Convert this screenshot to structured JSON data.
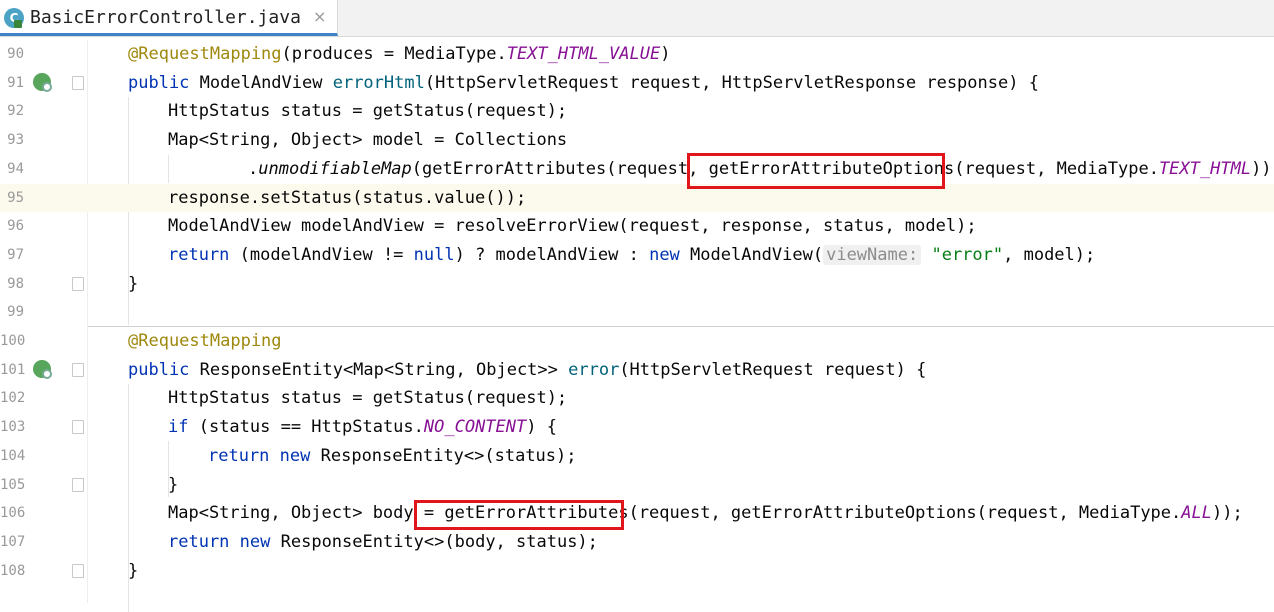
{
  "tab": {
    "title": "BasicErrorController.java",
    "icon_letter": "C",
    "close": "×"
  },
  "colors": {
    "keyword": "#0033b3",
    "annotation": "#9e880d",
    "static_field": "#871094",
    "method": "#00627a",
    "string": "#067d17",
    "highlight_box": "#e0161c"
  },
  "lines": [
    {
      "num": "90"
    },
    {
      "num": "91"
    },
    {
      "num": "92"
    },
    {
      "num": "93"
    },
    {
      "num": "94"
    },
    {
      "num": "95"
    },
    {
      "num": "96"
    },
    {
      "num": "97"
    },
    {
      "num": "98"
    },
    {
      "num": "99"
    },
    {
      "num": "100"
    },
    {
      "num": "101"
    },
    {
      "num": "102"
    },
    {
      "num": "103"
    },
    {
      "num": "104"
    },
    {
      "num": "105"
    },
    {
      "num": "106"
    },
    {
      "num": "107"
    },
    {
      "num": "108"
    }
  ],
  "code": {
    "l90": {
      "ann": "@RequestMapping",
      "a": "(produces = MediaType.",
      "st": "TEXT_HTML_VALUE",
      "b": ")"
    },
    "l91": {
      "kw": "public",
      "a": " ModelAndView ",
      "mt": "errorHtml",
      "b": "(HttpServletRequest request, HttpServletResponse response) {"
    },
    "l92": {
      "a": "HttpStatus status = getStatus(request);"
    },
    "l93": {
      "a": "Map<String, Object> model = Collections"
    },
    "l94": {
      "a": ".",
      "it": "unmodifiableMap",
      "b": "(getErrorAttributes(request, ",
      "hl": "getErrorAttributeOptions",
      "c": "(request, MediaType.",
      "st": "TEXT_HTML",
      "d": ")));"
    },
    "l95": {
      "a": "response.setStatus(status.value());"
    },
    "l96": {
      "a": "ModelAndView modelAndView = resolveErrorView(request, response, status, model);"
    },
    "l97": {
      "kw1": "return",
      "a": " (modelAndView != ",
      "kw2": "null",
      "b": ") ? modelAndView : ",
      "kw3": "new",
      "c": " ModelAndView(",
      "hint": "viewName:",
      "str": "\"error\"",
      "d": ", model);"
    },
    "l98": {
      "a": "}"
    },
    "l100": {
      "ann": "@RequestMapping"
    },
    "l101": {
      "kw": "public",
      "a": " ResponseEntity<Map<String, Object>> ",
      "mt": "error",
      "b": "(HttpServletRequest request) {"
    },
    "l102": {
      "a": "HttpStatus status = getStatus(request);"
    },
    "l103": {
      "kw": "if",
      "a": " (status == HttpStatus.",
      "st": "NO_CONTENT",
      "b": ") {"
    },
    "l104": {
      "kw1": "return",
      "a": " ",
      "kw2": "new",
      "b": " ResponseEntity<>(status);"
    },
    "l105": {
      "a": "}"
    },
    "l106": {
      "a": "Map<String, Object> body ",
      "hl": "= getErrorAttributes",
      "b": "(request, getErrorAttributeOptions(request, MediaType.",
      "st": "ALL",
      "c": "));"
    },
    "l107": {
      "kw1": "return",
      "a": " ",
      "kw2": "new",
      "b": " ResponseEntity<>(body, status);"
    },
    "l108": {
      "a": "}"
    }
  }
}
